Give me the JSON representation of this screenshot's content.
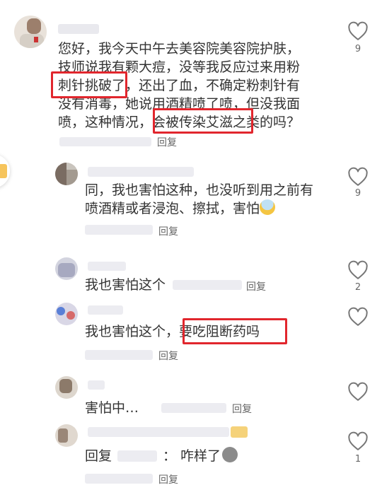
{
  "comments": [
    {
      "text_lines": [
        "您好，我今天中午去美容院美容院护肤，",
        "技师说我有颗大痘，没等我反应过来用粉",
        "刺针挑破了，还出了血，不确定粉刺针有",
        "没有消毒，她说用酒精喷了喷，但没我面",
        "喷，这种情况，会被传染艾滋之类的吗？"
      ],
      "reply_label": "回复",
      "like_count": "9"
    },
    {
      "text_lines": [
        "同，我也害怕这种，也没听到用之前有",
        "喷酒精或者浸泡、擦拭，害怕"
      ],
      "reply_label": "回复",
      "like_count": "9"
    },
    {
      "text": "我也害怕这个",
      "reply_label": "回复",
      "like_count": "2"
    },
    {
      "text": "我也害怕这个，要吃阻断药吗",
      "reply_label": "回复",
      "like_count": ""
    },
    {
      "text": "害怕中…",
      "reply_label": "回复",
      "like_count": ""
    },
    {
      "text_prefix": "回复",
      "text_suffix": "：  咋样了",
      "reply_label": "回复",
      "like_count": "1"
    }
  ],
  "icons": {
    "like": "heart-outline-icon",
    "emoji_fear": "screaming-face-emoji",
    "emoji_poop": "poop-emoji"
  },
  "colors": {
    "highlight_box": "#e1262d",
    "text": "#333333",
    "meta_text": "#666666"
  }
}
